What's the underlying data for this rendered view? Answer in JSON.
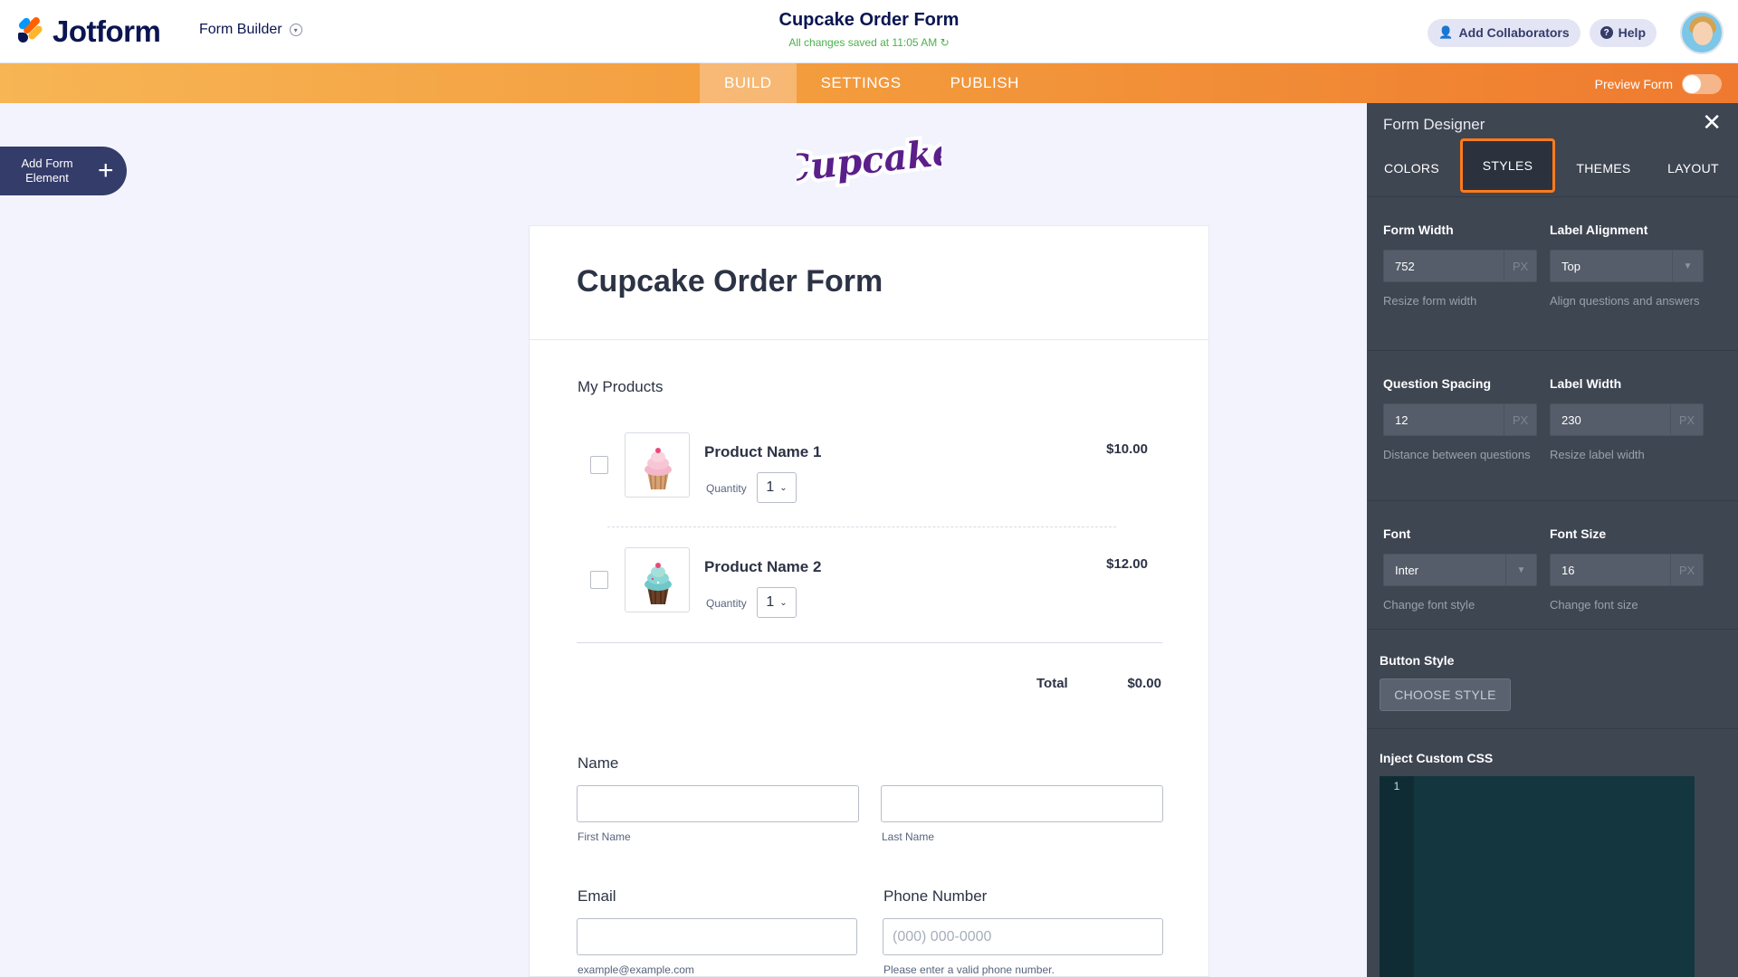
{
  "header": {
    "brand": "Jotform",
    "builder_label": "Form Builder",
    "form_title": "Cupcake Order Form",
    "save_status": "All changes saved at 11:05 AM",
    "add_collaborators": "Add Collaborators",
    "help": "Help"
  },
  "nav": {
    "tabs": [
      {
        "label": "BUILD",
        "active": true
      },
      {
        "label": "SETTINGS",
        "active": false
      },
      {
        "label": "PUBLISH",
        "active": false
      }
    ],
    "preview_label": "Preview Form",
    "preview_enabled": false
  },
  "add_element": {
    "label": "Add Form Element"
  },
  "brand_logo_text": "Cupcake",
  "form": {
    "title": "Cupcake Order Form",
    "products_label": "My Products",
    "products": [
      {
        "name": "Product Name 1",
        "qty_label": "Quantity",
        "qty": "1",
        "price": "$10.00"
      },
      {
        "name": "Product Name 2",
        "qty_label": "Quantity",
        "qty": "1",
        "price": "$12.00"
      }
    ],
    "total_label": "Total",
    "total_value": "$0.00",
    "name_label": "Name",
    "first_name_sub": "First Name",
    "last_name_sub": "Last Name",
    "email_label": "Email",
    "email_sub": "example@example.com",
    "phone_label": "Phone Number",
    "phone_placeholder": "(000) 000-0000",
    "phone_sub": "Please enter a valid phone number."
  },
  "designer": {
    "title": "Form Designer",
    "tabs": [
      {
        "label": "COLORS",
        "active": false
      },
      {
        "label": "STYLES",
        "active": true
      },
      {
        "label": "THEMES",
        "active": false
      },
      {
        "label": "LAYOUT",
        "active": false
      }
    ],
    "form_width": {
      "title": "Form Width",
      "value": "752",
      "unit": "PX",
      "hint": "Resize form width"
    },
    "label_alignment": {
      "title": "Label Alignment",
      "value": "Top",
      "hint": "Align questions and answers"
    },
    "question_spacing": {
      "title": "Question Spacing",
      "value": "12",
      "unit": "PX",
      "hint": "Distance between questions"
    },
    "label_width": {
      "title": "Label Width",
      "value": "230",
      "unit": "PX",
      "hint": "Resize label width"
    },
    "font": {
      "title": "Font",
      "value": "Inter",
      "hint": "Change font style"
    },
    "font_size": {
      "title": "Font Size",
      "value": "16",
      "unit": "PX",
      "hint": "Change font size"
    },
    "button_style": {
      "title": "Button Style",
      "button": "CHOOSE STYLE"
    },
    "custom_css": {
      "title": "Inject Custom CSS",
      "line": "1"
    }
  },
  "colors": {
    "accent": "#ff7b1c",
    "panel_bg": "#3e4652",
    "brand_navy": "#0a1551",
    "save_green": "#4cb04c"
  }
}
